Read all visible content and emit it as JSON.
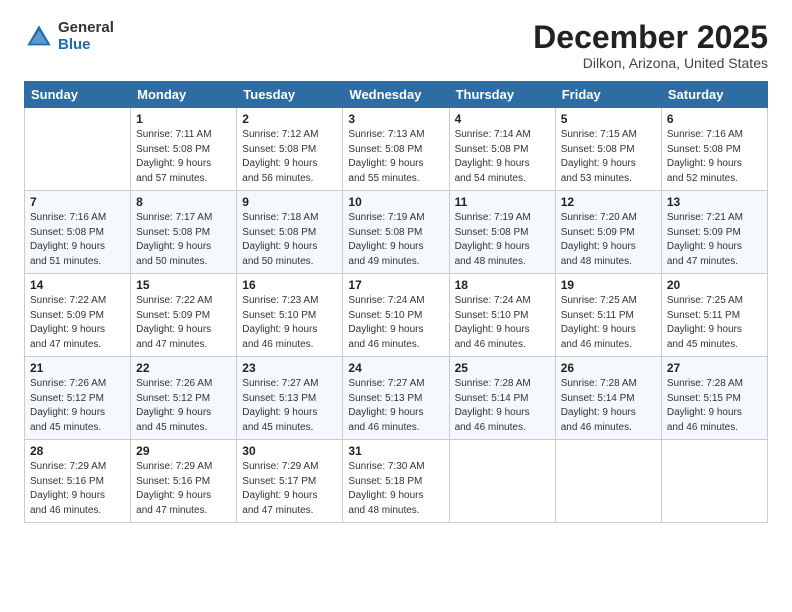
{
  "logo": {
    "general": "General",
    "blue": "Blue"
  },
  "header": {
    "month": "December 2025",
    "location": "Dilkon, Arizona, United States"
  },
  "weekdays": [
    "Sunday",
    "Monday",
    "Tuesday",
    "Wednesday",
    "Thursday",
    "Friday",
    "Saturday"
  ],
  "weeks": [
    [
      {
        "day": "",
        "info": ""
      },
      {
        "day": "1",
        "info": "Sunrise: 7:11 AM\nSunset: 5:08 PM\nDaylight: 9 hours\nand 57 minutes."
      },
      {
        "day": "2",
        "info": "Sunrise: 7:12 AM\nSunset: 5:08 PM\nDaylight: 9 hours\nand 56 minutes."
      },
      {
        "day": "3",
        "info": "Sunrise: 7:13 AM\nSunset: 5:08 PM\nDaylight: 9 hours\nand 55 minutes."
      },
      {
        "day": "4",
        "info": "Sunrise: 7:14 AM\nSunset: 5:08 PM\nDaylight: 9 hours\nand 54 minutes."
      },
      {
        "day": "5",
        "info": "Sunrise: 7:15 AM\nSunset: 5:08 PM\nDaylight: 9 hours\nand 53 minutes."
      },
      {
        "day": "6",
        "info": "Sunrise: 7:16 AM\nSunset: 5:08 PM\nDaylight: 9 hours\nand 52 minutes."
      }
    ],
    [
      {
        "day": "7",
        "info": "Sunrise: 7:16 AM\nSunset: 5:08 PM\nDaylight: 9 hours\nand 51 minutes."
      },
      {
        "day": "8",
        "info": "Sunrise: 7:17 AM\nSunset: 5:08 PM\nDaylight: 9 hours\nand 50 minutes."
      },
      {
        "day": "9",
        "info": "Sunrise: 7:18 AM\nSunset: 5:08 PM\nDaylight: 9 hours\nand 50 minutes."
      },
      {
        "day": "10",
        "info": "Sunrise: 7:19 AM\nSunset: 5:08 PM\nDaylight: 9 hours\nand 49 minutes."
      },
      {
        "day": "11",
        "info": "Sunrise: 7:19 AM\nSunset: 5:08 PM\nDaylight: 9 hours\nand 48 minutes."
      },
      {
        "day": "12",
        "info": "Sunrise: 7:20 AM\nSunset: 5:09 PM\nDaylight: 9 hours\nand 48 minutes."
      },
      {
        "day": "13",
        "info": "Sunrise: 7:21 AM\nSunset: 5:09 PM\nDaylight: 9 hours\nand 47 minutes."
      }
    ],
    [
      {
        "day": "14",
        "info": "Sunrise: 7:22 AM\nSunset: 5:09 PM\nDaylight: 9 hours\nand 47 minutes."
      },
      {
        "day": "15",
        "info": "Sunrise: 7:22 AM\nSunset: 5:09 PM\nDaylight: 9 hours\nand 47 minutes."
      },
      {
        "day": "16",
        "info": "Sunrise: 7:23 AM\nSunset: 5:10 PM\nDaylight: 9 hours\nand 46 minutes."
      },
      {
        "day": "17",
        "info": "Sunrise: 7:24 AM\nSunset: 5:10 PM\nDaylight: 9 hours\nand 46 minutes."
      },
      {
        "day": "18",
        "info": "Sunrise: 7:24 AM\nSunset: 5:10 PM\nDaylight: 9 hours\nand 46 minutes."
      },
      {
        "day": "19",
        "info": "Sunrise: 7:25 AM\nSunset: 5:11 PM\nDaylight: 9 hours\nand 46 minutes."
      },
      {
        "day": "20",
        "info": "Sunrise: 7:25 AM\nSunset: 5:11 PM\nDaylight: 9 hours\nand 45 minutes."
      }
    ],
    [
      {
        "day": "21",
        "info": "Sunrise: 7:26 AM\nSunset: 5:12 PM\nDaylight: 9 hours\nand 45 minutes."
      },
      {
        "day": "22",
        "info": "Sunrise: 7:26 AM\nSunset: 5:12 PM\nDaylight: 9 hours\nand 45 minutes."
      },
      {
        "day": "23",
        "info": "Sunrise: 7:27 AM\nSunset: 5:13 PM\nDaylight: 9 hours\nand 45 minutes."
      },
      {
        "day": "24",
        "info": "Sunrise: 7:27 AM\nSunset: 5:13 PM\nDaylight: 9 hours\nand 46 minutes."
      },
      {
        "day": "25",
        "info": "Sunrise: 7:28 AM\nSunset: 5:14 PM\nDaylight: 9 hours\nand 46 minutes."
      },
      {
        "day": "26",
        "info": "Sunrise: 7:28 AM\nSunset: 5:14 PM\nDaylight: 9 hours\nand 46 minutes."
      },
      {
        "day": "27",
        "info": "Sunrise: 7:28 AM\nSunset: 5:15 PM\nDaylight: 9 hours\nand 46 minutes."
      }
    ],
    [
      {
        "day": "28",
        "info": "Sunrise: 7:29 AM\nSunset: 5:16 PM\nDaylight: 9 hours\nand 46 minutes."
      },
      {
        "day": "29",
        "info": "Sunrise: 7:29 AM\nSunset: 5:16 PM\nDaylight: 9 hours\nand 47 minutes."
      },
      {
        "day": "30",
        "info": "Sunrise: 7:29 AM\nSunset: 5:17 PM\nDaylight: 9 hours\nand 47 minutes."
      },
      {
        "day": "31",
        "info": "Sunrise: 7:30 AM\nSunset: 5:18 PM\nDaylight: 9 hours\nand 48 minutes."
      },
      {
        "day": "",
        "info": ""
      },
      {
        "day": "",
        "info": ""
      },
      {
        "day": "",
        "info": ""
      }
    ]
  ]
}
